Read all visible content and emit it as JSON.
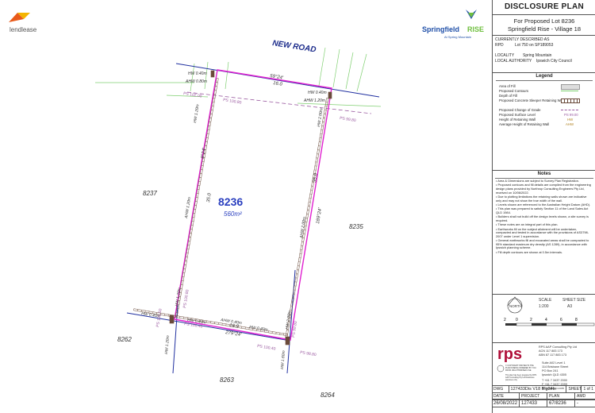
{
  "logos": {
    "left": "lendlease",
    "right_brand": "Springfield",
    "right_brand2": "RISE",
    "right_tag": "At Spring Mountain"
  },
  "title": "DISCLOSURE PLAN",
  "subtitle_1": "For Proposed Lot 8236",
  "subtitle_2": "Springfield Rise - Village 18",
  "info": {
    "header": "CURRENTLY DESCRIBED AS",
    "rpd_label": "RPD",
    "rpd_value": "Lot 750 on SP189053",
    "locality_label": "LOCALITY",
    "locality_value": "Spring Mountain",
    "authority_label": "LOCAL AUTHORITY",
    "authority_value": "Ipswich City Council"
  },
  "legend": {
    "title": "Legend",
    "items": [
      "Area of Fill",
      "Proposed Contours",
      "Depth of Fill",
      "Proposed Concrete Sleeper Retaining Wall",
      "Proposed Change of Grade",
      "Proposed Surface Level",
      "Height of Retaining Wall",
      "Average Height of Retaining Wall"
    ],
    "sample_ps": "PS 99.00",
    "sample_hw": "HW",
    "sample_ahw": "AHW"
  },
  "notes": {
    "title": "Notes",
    "items": [
      "Area & Dimensions are subject to Survey Plan Registration.",
      "Proposed contours and fill details are compiled from the engineering design plans provided by Northrop Consulting Engineers Pty Ltd, received on 10/06/2022.",
      "Due to plotting limitations the retaining walls shown are indicative only and may not show the true width of the wall.",
      "Levels shown are referenced to the Australian Height Datum (AHD).",
      "This plan was prepared to satisfy Section 11 of the Land Sales Act QLD 1984.",
      "Builders shall not build off the design levels shown, a site survey is required.",
      "These notes are an integral part of this plan.",
      "Earthworks fill on the subject allotment will be undertaken, compacted and tested in accordance with the provisions of AS3798-2007 under Level 1 supervision.",
      "General earthworks fill and excavated areas shall be compacted to 95% standard maximum dry density (AS 1289), in accordance with Ipswich planning scheme.",
      "Fill depth contours are shown at 0.5m intervals."
    ]
  },
  "scale": {
    "north": "NORTH",
    "scale_label": "SCALE",
    "scale_value": "1:200",
    "size_label": "SHEET SIZE",
    "size_value": "A3",
    "ticks": [
      "2",
      "0",
      "2",
      "4",
      "6",
      "8"
    ]
  },
  "company": {
    "logo": "rps",
    "name": "RPS AAP Consulting Pty Ltd",
    "acn": "ACN 117 883 173",
    "abn": "ABN 87 117 883 173",
    "address": [
      "Suite A02 Level 1",
      "114 Brisbane Street",
      "PO Box 241",
      "Ipswich QLD 4305"
    ],
    "phone": "T +61 7 3437 2000",
    "fax": "F +61 7 3437 2099",
    "web": "W rpsgroup.com",
    "copyright": "© COPYRIGHT PROTECTS THE PLAN/S BEING ORDERED BY YOU FROM UNAUTHORISED USE",
    "disclaimer": "This plan has been prepared by RPS AAP Consulting Pty Ltd Disclosure purposes only"
  },
  "footer": {
    "dwg_label": "DWG",
    "dwg_value": "127433Dis V18 Blg24b",
    "sheet_label": "SHEET",
    "sheet_value": "1 of 1",
    "date_label": "DATE",
    "date_value": "26/08/2022",
    "project_label": "PROJECT",
    "project_value": "127433",
    "plan_label": "PLAN",
    "plan_value": "67/8236",
    "amd_label": "AMD",
    "amd_value": "-"
  },
  "plan": {
    "road": "NEW ROAD",
    "lot": "8236",
    "area": "560m²",
    "neighbors": [
      "8237",
      "8235",
      "8262",
      "8263",
      "8264"
    ],
    "top_bearing": "59°24'",
    "top_dist": "16.0",
    "bottom_bearing": "279°24'",
    "bottom_dist": "16.0",
    "left_bearing": "9°24'",
    "left_dist": "35.0",
    "right_bearing": "189°24'",
    "right_dist": "35.0",
    "labels": {
      "hw_tl": "HW 0.40m",
      "ahw_tl": "AHW 0.80m",
      "hw_tr": "HW 0.40m",
      "ahw_tr": "AHW 1.20m",
      "hw_left_top": "HW 1.20m",
      "ahw_left": "AHW 1.20m",
      "hw_left_bot": "HW 1.20m",
      "hw_right_top": "HW 2.00m",
      "ahw_right": "AHW 2.00m",
      "hw_right_bot": "HW 2.00m",
      "ps_tl": "PS 102.00",
      "ps_tl2": "PS 100.80",
      "ps_tr": "PS 99.80",
      "hw_bl": "HW 0.40m",
      "hw_bl2": "HW 0.40m",
      "ahw_bottom": "AHW 0.40m",
      "hw_bottom_r": "HW 0.40m",
      "ps_bl": "PS 100.80",
      "ps_bl2": "PS 101.60",
      "ps_bottom": "PS 100.40",
      "ps_br": "PS 99.80",
      "ps_br2": "PS 100.40",
      "ps_br3": "PS 98.80",
      "hw_bottom_left": "HW 1.20m",
      "hw_bottom_right": "HW 1.60m"
    }
  },
  "colors": {
    "boundary": "#e020d0",
    "easement": "#2030a0",
    "wall": "#6a4a3a",
    "contour": "#7fcf70",
    "ps": "#9a5aa0",
    "brand_green": "#6fbf3f",
    "rps_red": "#b0103a"
  }
}
